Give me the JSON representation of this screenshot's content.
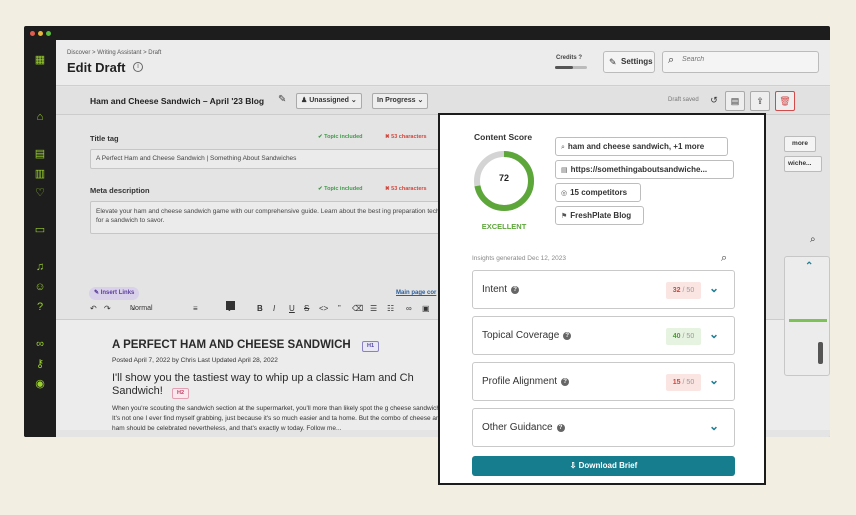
{
  "window": {
    "dot_colors": [
      "#e25b4f",
      "#e8b63c",
      "#5bbf3f"
    ]
  },
  "sidebar": {
    "icons": [
      "grid-logo-icon",
      "home-icon",
      "document-add-icon",
      "bar-chart-icon",
      "heartbeat-icon",
      "monitor-icon",
      "bell-icon",
      "users-icon",
      "help-icon",
      "link-icon",
      "key-icon",
      "user-circle-icon"
    ],
    "accent": "#9bd12f"
  },
  "header": {
    "breadcrumb": [
      "Discover",
      "Writing Assistant",
      "Draft"
    ],
    "title": "Edit Draft",
    "credits_label": "Credits",
    "credits_fraction": 0.55,
    "settings_label": "Settings",
    "search_placeholder": "Search"
  },
  "docbar": {
    "doc_title": "Ham and Cheese Sandwich – April '23 Blog",
    "assignee": "Unassigned",
    "status": "In Progress",
    "saved_text": "Draft saved"
  },
  "form": {
    "title_tag_label": "Title tag",
    "topic_included": "Topic included",
    "title_chars": "53 characters",
    "title_value": "A Perfect Ham and Cheese Sandwich | Something About Sandwiches",
    "meta_label": "Meta description",
    "meta_chars": "53 characters",
    "meta_value": "Elevate your ham and cheese sandwich game with our comprehensive guide. Learn about the best ing preparation techniques for a sandwich to savor.",
    "insert_links": "Insert Links",
    "main_page": "Main page cor"
  },
  "toolbar": {
    "text_style": "Normal text"
  },
  "editor": {
    "h1": "A PERFECT HAM AND CHEESE SANDWICH",
    "h1_tag": "H1",
    "posted": "Posted April 7, 2022 by Chris Last Updated April 28, 2022",
    "h2": "I'll show you the tastiest way to whip up a classic Ham and Ch Sandwich!",
    "h2_tag": "H2",
    "paragraph": "When you're scouting the sandwich section at the supermarket, you'll more than likely spot the g cheese sandwich. It's not one I ever find myself grabbing, just because it's so much easier and ta home. But the combo of cheese and ham should be celebrated nevertheless, and that's exactly w today. Follow me..."
  },
  "behind_panel": {
    "more": "more",
    "sandwiche": "wiche..."
  },
  "panel": {
    "content_score_label": "Content Score",
    "score": "72",
    "score_fraction": 0.72,
    "rating": "EXCELLENT",
    "chips": [
      {
        "icon": "search-icon",
        "text": "ham and cheese sandwich, +1 more"
      },
      {
        "icon": "page-icon",
        "text": "https://somethingaboutsandwiche..."
      },
      {
        "icon": "target-icon",
        "text": "15 competitors"
      },
      {
        "icon": "flag-icon",
        "text": "FreshPlate Blog"
      }
    ],
    "insights_text": "Insights generated Dec 12, 2023",
    "sections": [
      {
        "label": "Intent",
        "score": "32",
        "max": "/ 50",
        "status": "red"
      },
      {
        "label": "Topical Coverage",
        "score": "40",
        "max": "/ 50",
        "status": "green"
      },
      {
        "label": "Profile Alignment",
        "score": "15",
        "max": "/ 50",
        "status": "red"
      },
      {
        "label": "Other Guidance",
        "score": "",
        "max": "",
        "status": "none"
      }
    ],
    "download_label": "Download Brief",
    "accent": "#167d8f",
    "score_color": "#5da73a"
  }
}
